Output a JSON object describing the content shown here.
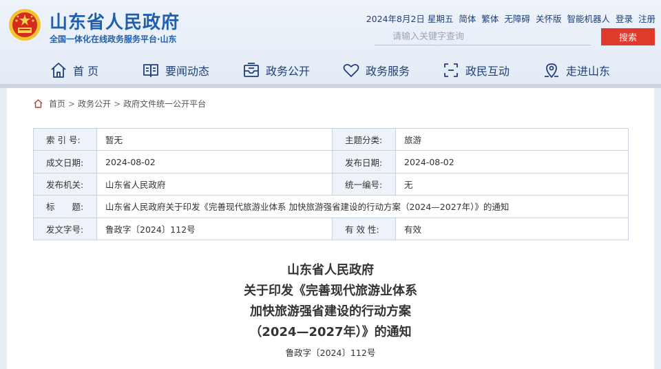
{
  "header": {
    "title": "山东省人民政府",
    "subtitle": "全国一体化在线政务服务平台·山东",
    "toplinks": [
      "2024年8月2日 星期五",
      "简体",
      "繁体",
      "无障碍",
      "关怀版",
      "智能机器人",
      "登录",
      "注册"
    ],
    "search_placeholder": "请输入关键字查询",
    "search_button": "搜索"
  },
  "nav": {
    "items": [
      {
        "label": "首 页",
        "icon": "home-icon"
      },
      {
        "label": "要闻动态",
        "icon": "newspaper-icon"
      },
      {
        "label": "政务公开",
        "icon": "inbox-icon"
      },
      {
        "label": "政务服务",
        "icon": "heart-icon"
      },
      {
        "label": "政民互动",
        "icon": "interaction-icon"
      },
      {
        "label": "走进山东",
        "icon": "location-icon"
      }
    ]
  },
  "breadcrumb": {
    "items": [
      "首页",
      "政务公开",
      "政府文件统一公开平台"
    ],
    "separator": ">"
  },
  "meta": {
    "index_label": "索 引 号:",
    "index_value": "暂无",
    "topic_label": "主题分类:",
    "topic_value": "旅游",
    "created_label": "成文日期:",
    "created_value": "2024-08-02",
    "published_label": "发布日期:",
    "published_value": "2024-08-02",
    "issuer_label": "发布机关:",
    "issuer_value": "山东省人民政府",
    "serial_label": "统一编号:",
    "serial_value": "无",
    "title_label": "标　　题:",
    "title_value": "山东省人民政府关于印发《完善现代旅游业体系 加快旅游强省建设的行动方案（2024—2027年）》的通知",
    "docno_label": "发文字号:",
    "docno_value": "鲁政字〔2024〕112号",
    "validity_label": "有 效 性:",
    "validity_value": "有效",
    "validity_color": "#e0301e"
  },
  "document": {
    "title_lines": [
      "山东省人民政府",
      "关于印发《完善现代旅游业体系",
      "加快旅游强省建设的行动方案",
      "（2024—2027年）》的通知"
    ],
    "number": "鲁政字〔2024〕112号"
  },
  "colors": {
    "brand": "#1f5fae",
    "nav_text": "#1f3f7a",
    "search_button": "#df3a2b"
  }
}
